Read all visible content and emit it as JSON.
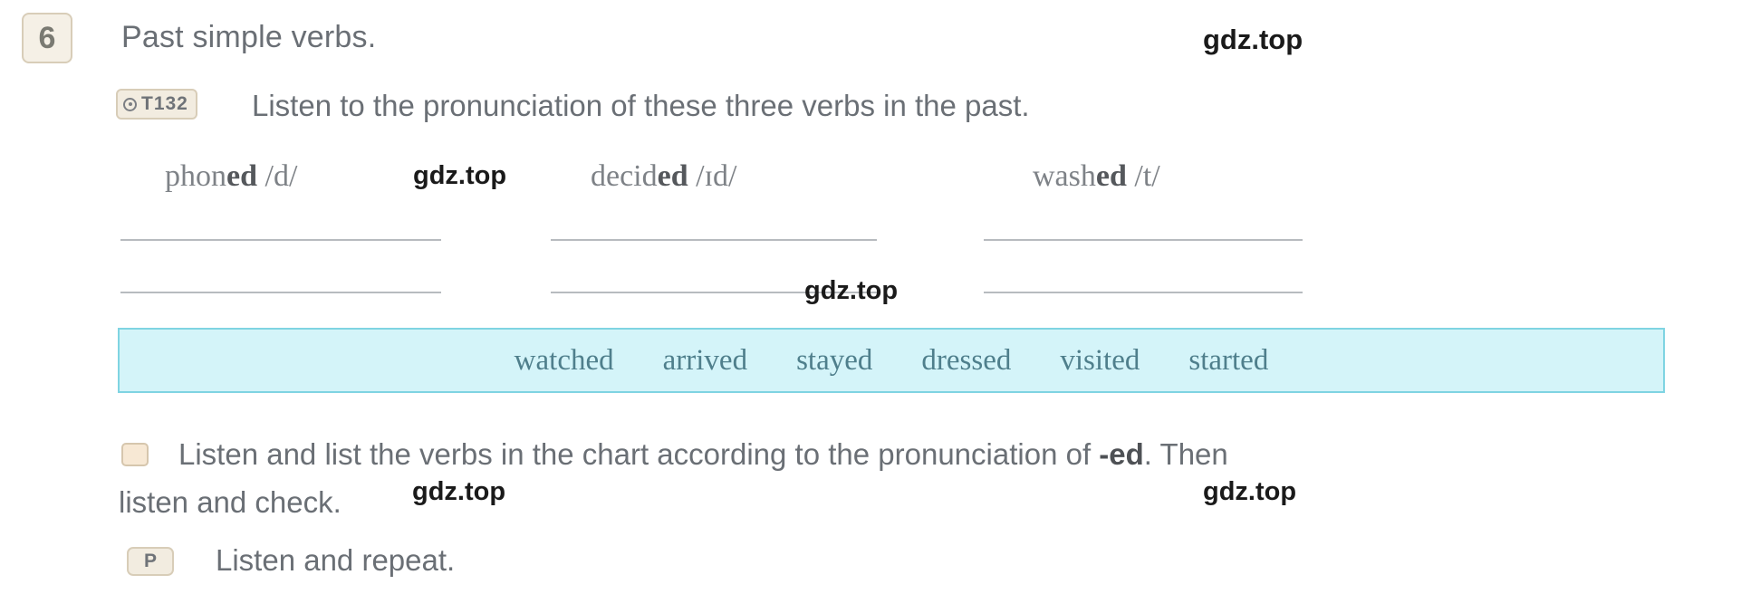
{
  "exercise": {
    "number": "6",
    "title": "Past simple verbs."
  },
  "track": {
    "label": "T132",
    "icon": "audio-disc-icon"
  },
  "instructions": {
    "listen_pronunciation": "Listen to the pronunciation of these three verbs in the past.",
    "chart_task_part1": "Listen and list the verbs in the chart according to the pronunciation of",
    "chart_task_bold": "-ed",
    "chart_task_part2": ". Then",
    "chart_task_line2": "listen and check.",
    "listen_repeat": "Listen and repeat."
  },
  "pronunciation_tag": "P",
  "verbs": [
    {
      "stem": "phon",
      "ending": "ed",
      "ipa": "/d/"
    },
    {
      "stem": "decid",
      "ending": "ed",
      "ipa": "/ɪd/"
    },
    {
      "stem": "wash",
      "ending": "ed",
      "ipa": "/t/"
    }
  ],
  "answer_lines": {
    "columns": 3,
    "rows_per_column": 2,
    "values": [
      "",
      "",
      "",
      "",
      "",
      ""
    ]
  },
  "word_bank": [
    "watched",
    "arrived",
    "stayed",
    "dressed",
    "visited",
    "started"
  ],
  "watermarks": [
    "gdz.top",
    "gdz.top",
    "gdz.top",
    "gdz.top",
    "gdz.top"
  ],
  "colors": {
    "text": "#6a6f75",
    "badge_border": "#d8cdb8",
    "badge_fill": "#f5f0e6",
    "wordbank_border": "#7fd4e2",
    "wordbank_fill": "#d4f4f9",
    "wordbank_text": "#4f7f8c",
    "rule_line": "#b7bbbf",
    "checkbox_fill": "#f7e8d4"
  }
}
